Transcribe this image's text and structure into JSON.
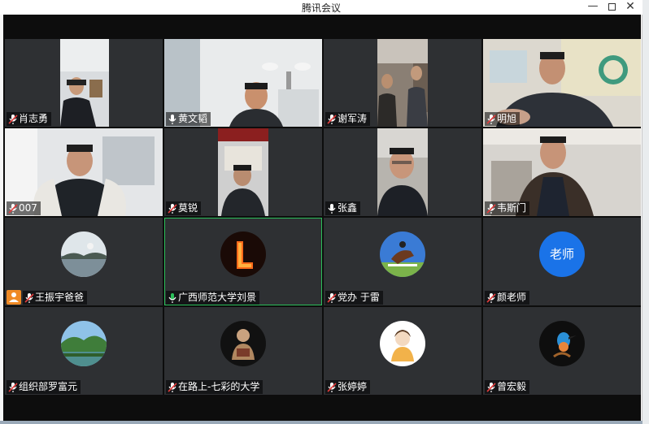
{
  "window": {
    "title": "腾讯会议",
    "minimize_glyph": "—",
    "close_glyph": "✕"
  },
  "participants": [
    {
      "name": "肖志勇",
      "mic": "muted"
    },
    {
      "name": "黄文韬",
      "mic": "on"
    },
    {
      "name": "谢军涛",
      "mic": "muted"
    },
    {
      "name": "明旭",
      "mic": "muted"
    },
    {
      "name": "007",
      "mic": "muted"
    },
    {
      "name": "莫锐",
      "mic": "muted"
    },
    {
      "name": "张鑫",
      "mic": "on"
    },
    {
      "name": "韦斯门",
      "mic": "muted"
    },
    {
      "name": "王振宇爸爸",
      "mic": "muted",
      "host": true,
      "avatar": "lake-landscape"
    },
    {
      "name": "广西师范大学刘景",
      "mic": "speaking",
      "avatar": "fire-letter-L"
    },
    {
      "name": "党办 于雷",
      "mic": "muted",
      "avatar": "horse-jumping"
    },
    {
      "name": "颜老师",
      "mic": "muted",
      "avatar_text": "老师"
    },
    {
      "name": "组织部罗富元",
      "mic": "muted",
      "avatar": "forest-river"
    },
    {
      "name": "在路上-七彩的大学",
      "mic": "muted",
      "avatar": "figurine"
    },
    {
      "name": "张婷婷",
      "mic": "muted",
      "avatar": "cartoon-girl"
    },
    {
      "name": "曾宏毅",
      "mic": "muted",
      "avatar": "kingfisher-bird"
    }
  ],
  "colors": {
    "tile_bg": "#2e3033",
    "speaking_border": "#2bbf5a",
    "host_badge": "#f08a24",
    "letter_avatar": "#1a73e8",
    "muted_icon": "#e23c3c"
  }
}
